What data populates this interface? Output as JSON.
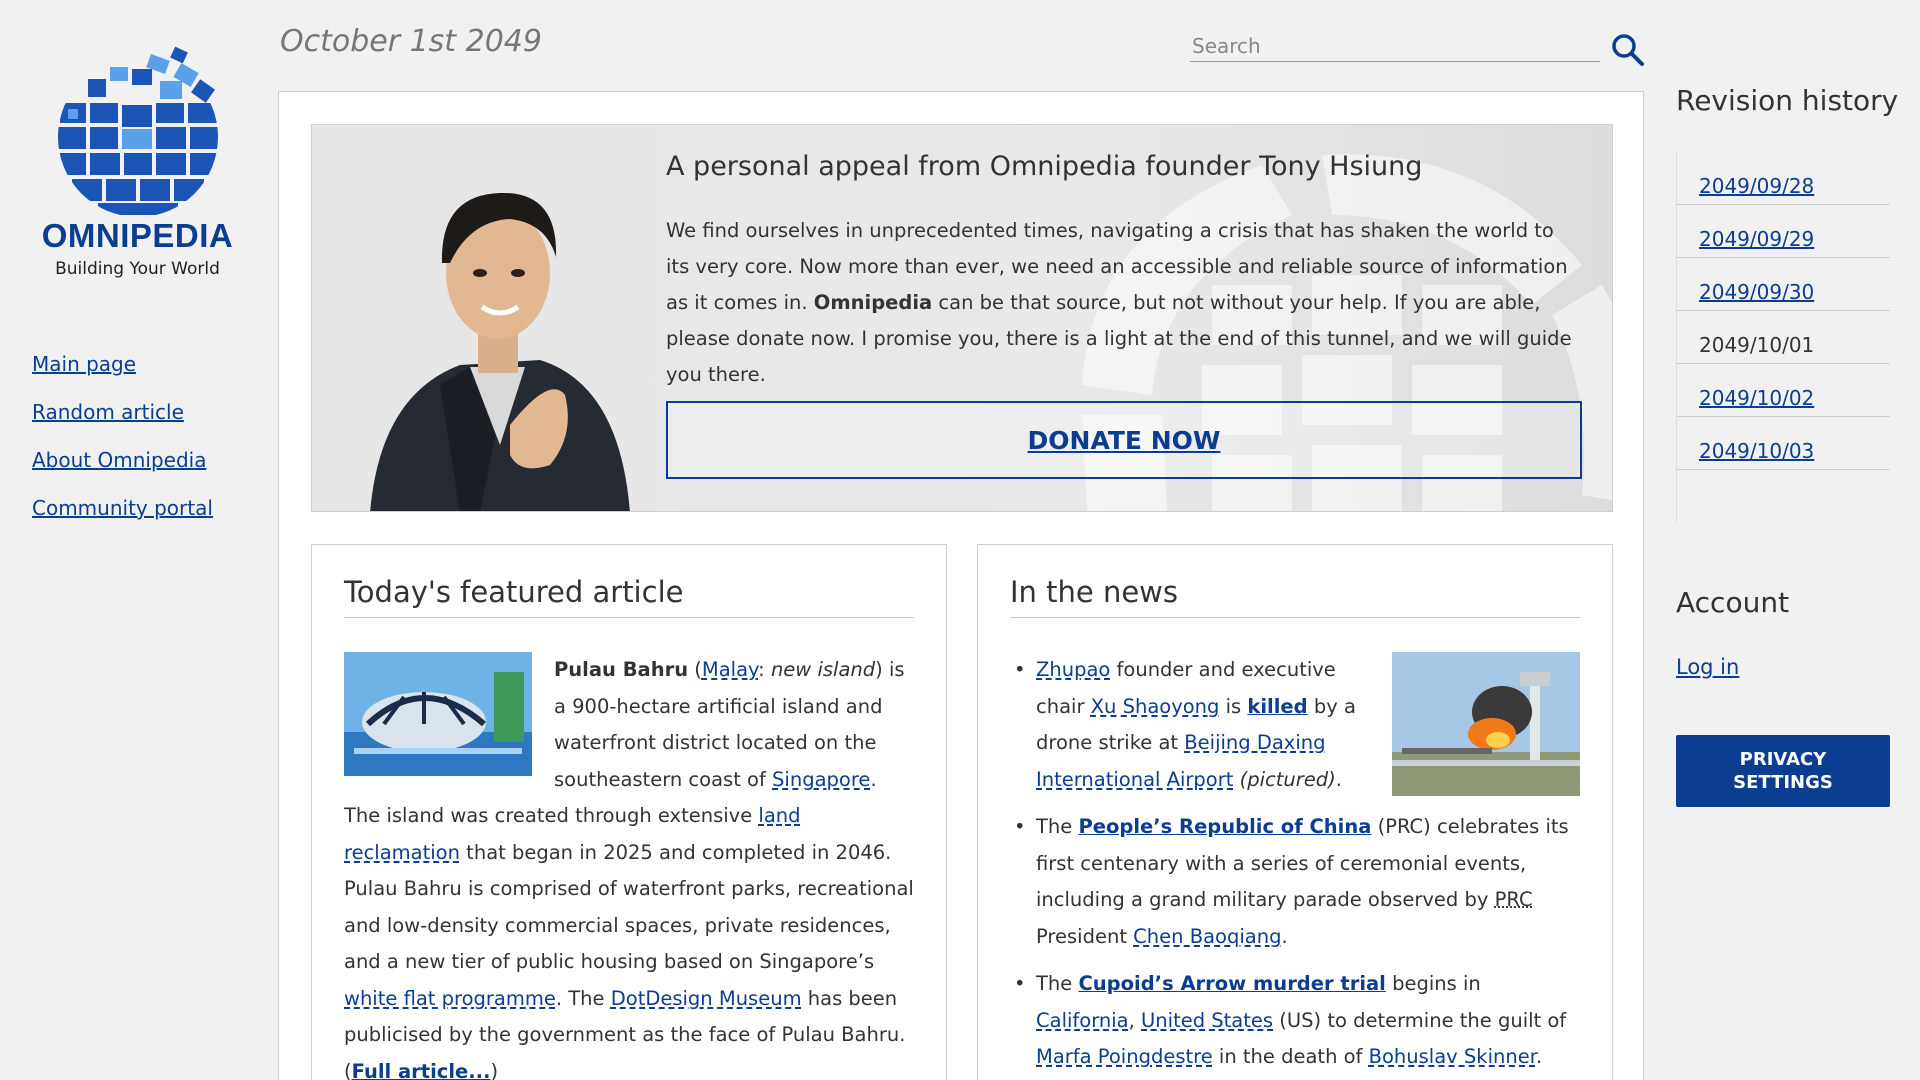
{
  "brand": {
    "name": "OMNIPEDIA",
    "tagline": "Building Your World"
  },
  "left_nav": {
    "items": [
      {
        "label": "Main page"
      },
      {
        "label": "Random article"
      },
      {
        "label": "About Omnipedia"
      },
      {
        "label": "Community portal"
      }
    ]
  },
  "header": {
    "date": "October 1st 2049",
    "search_placeholder": "Search"
  },
  "appeal": {
    "title": "A personal appeal from Omnipedia founder Tony Hsiung",
    "body_1": "We find ourselves in unprecedented times, navigating a crisis that has shaken the world to its very core. Now more than ever, we need an accessible and reliable source of information as it comes in. ",
    "body_bold": "Omnipedia",
    "body_2": " can be that source, but not without your help. If you are able, please donate now. I promise you, there is a light at the end of this tunnel, and we will guide you there.",
    "donate_label": "DONATE NOW"
  },
  "featured": {
    "heading": "Today's featured article",
    "t1": "Pulau Bahru",
    "t2": " (",
    "l_malay": "Malay",
    "t3": ": ",
    "t4_italic": "new island",
    "t5": ") is a 900-hectare artificial island and waterfront district located on the southeastern coast of ",
    "l_singapore": "Singapore",
    "t6": ". The island was created through extensive ",
    "l_land": "land reclamation",
    "t7": " that began in 2025 and completed in 2046. Pulau Bahru is comprised of waterfront parks, recreational and low-density commercial spaces, private residences, and a new tier of public housing based on Singapore’s ",
    "l_white": "white flat programme",
    "t8": ". The ",
    "l_dotdesign": "DotDesign Museum",
    "t9": " has been publicised by the government as the face of Pulau Bahru. (",
    "l_full": "Full article...",
    "t10": ")"
  },
  "news": {
    "heading": "In the news",
    "i1": {
      "l_zhupao": "Zhupao",
      "t1": " founder and executive chair ",
      "l_xu": "Xu Shaoyong",
      "t2": " is ",
      "l_killed": "killed",
      "t3": " by a drone strike at ",
      "l_airport": "Beijing Daxing International Airport",
      "t4_italic": " (pictured)",
      "t5": "."
    },
    "i2": {
      "t1": "The ",
      "l_prc": "People’s Republic of China",
      "t2": " (PRC) celebrates its first centenary with a series of ceremonial events, including a grand military parade observed by ",
      "abbr": "PRC",
      "t3": " President ",
      "l_chen": "Chen Baoqiang",
      "t4": "."
    },
    "i3": {
      "t1": "The ",
      "l_trial": "Cupoid’s Arrow murder trial",
      "t2": " begins in ",
      "l_ca": "California",
      "t3": ", ",
      "l_us": "United States",
      "t4": " (US) to determine the guilt of ",
      "l_marfa": "Marfa Poingdestre",
      "t5": " in the death of ",
      "l_bohuslav": "Bohuslav Skinner",
      "t6": "."
    }
  },
  "revision": {
    "title": "Revision history",
    "items": [
      {
        "label": "2049/09/28"
      },
      {
        "label": "2049/09/29"
      },
      {
        "label": "2049/09/30"
      },
      {
        "label": "2049/10/01"
      },
      {
        "label": "2049/10/02"
      },
      {
        "label": "2049/10/03"
      }
    ]
  },
  "account": {
    "title": "Account",
    "login_label": "Log in",
    "privacy_line1": "PRIVACY",
    "privacy_line2": "SETTINGS"
  },
  "colors": {
    "brand_blue": "#0b3d91",
    "light_blue": "#4a90e2",
    "background": "#f1f1f2"
  },
  "icons": [
    "globe-logo-icon",
    "search-icon"
  ]
}
